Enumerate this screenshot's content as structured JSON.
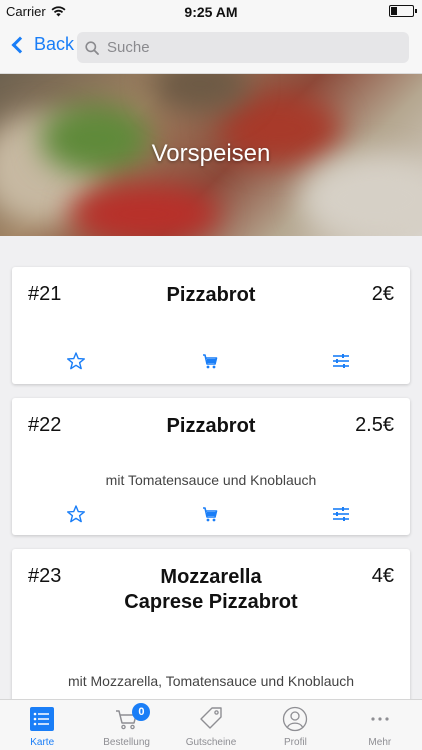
{
  "status_bar": {
    "carrier": "Carrier",
    "time": "9:25 AM"
  },
  "nav": {
    "back_label": "Back",
    "search_placeholder": "Suche"
  },
  "hero": {
    "title": "Vorspeisen"
  },
  "colors": {
    "accent": "#1a7ef7",
    "inactive": "#8e8e93"
  },
  "items": [
    {
      "number": "#21",
      "title": "Pizzabrot",
      "price": "2€",
      "description": ""
    },
    {
      "number": "#22",
      "title": "Pizzabrot",
      "price": "2.5€",
      "description": "mit Tomatensauce und Knoblauch"
    },
    {
      "number": "#23",
      "title": "Mozzarella Caprese Pizzabrot",
      "price": "4€",
      "description": "mit Mozzarella, Tomatensauce und Knoblauch"
    }
  ],
  "item_actions": [
    "star-icon",
    "cart-icon",
    "sliders-icon"
  ],
  "tabs": [
    {
      "label": "Karte",
      "icon": "menu-list-icon",
      "active": true
    },
    {
      "label": "Bestellung",
      "icon": "cart-icon",
      "badge": "0"
    },
    {
      "label": "Gutscheine",
      "icon": "tag-icon"
    },
    {
      "label": "Profil",
      "icon": "user-icon"
    },
    {
      "label": "Mehr",
      "icon": "more-icon"
    }
  ]
}
